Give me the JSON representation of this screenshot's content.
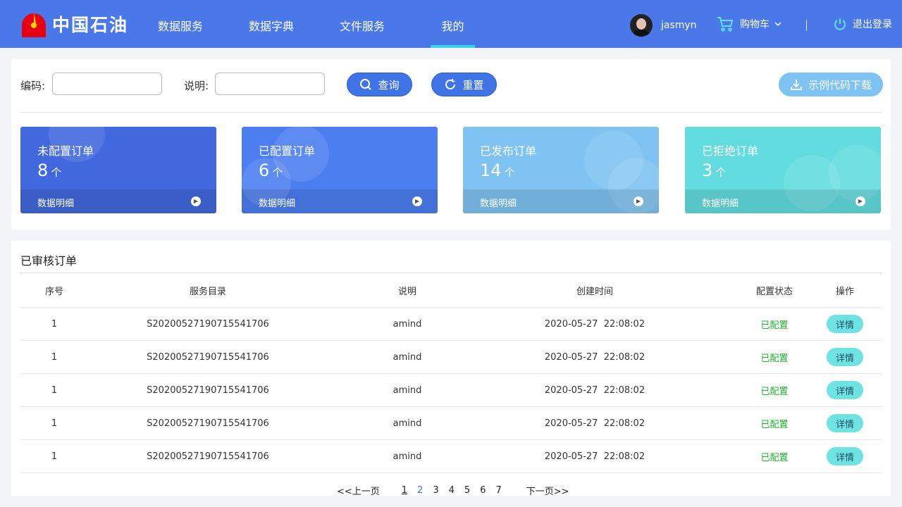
{
  "header": {
    "brand": "中国石油",
    "nav": [
      {
        "label": "数据服务",
        "active": false
      },
      {
        "label": "数据字典",
        "active": false
      },
      {
        "label": "文件服务",
        "active": false
      },
      {
        "label": "我的",
        "active": true
      }
    ],
    "username": "jasmyn",
    "cart_label": "购物车",
    "logout_label": "退出登录"
  },
  "filters": {
    "code_label": "编码:",
    "code_value": "",
    "desc_label": "说明:",
    "desc_value": "",
    "search_label": "查询",
    "reset_label": "重置",
    "download_label": "示例代码下载"
  },
  "cards": [
    {
      "title": "未配置订单",
      "count": "8",
      "unit": "个",
      "footer": "数据明细",
      "color": "#4169dd"
    },
    {
      "title": "已配置订单",
      "count": "6",
      "unit": "个",
      "footer": "数据明细",
      "color": "#4c7ef0"
    },
    {
      "title": "已发布订单",
      "count": "14",
      "unit": "个",
      "footer": "数据明细",
      "color": "#7ec3f2"
    },
    {
      "title": "已拒绝订单",
      "count": "3",
      "unit": "个",
      "footer": "数据明细",
      "color": "#62dcde"
    }
  ],
  "table": {
    "title": "已审核订单",
    "columns": [
      "序号",
      "服务目录",
      "说明",
      "创建时间",
      "配置状态",
      "操作"
    ],
    "rows": [
      {
        "index": "1",
        "catalog": "S20200527190715541706",
        "desc": "amind",
        "created": "2020-05-27  22:08:02",
        "status": "已配置",
        "action": "详情"
      },
      {
        "index": "1",
        "catalog": "S20200527190715541706",
        "desc": "amind",
        "created": "2020-05-27  22:08:02",
        "status": "已配置",
        "action": "详情"
      },
      {
        "index": "1",
        "catalog": "S20200527190715541706",
        "desc": "amind",
        "created": "2020-05-27  22:08:02",
        "status": "已配置",
        "action": "详情"
      },
      {
        "index": "1",
        "catalog": "S20200527190715541706",
        "desc": "amind",
        "created": "2020-05-27  22:08:02",
        "status": "已配置",
        "action": "详情"
      },
      {
        "index": "1",
        "catalog": "S20200527190715541706",
        "desc": "amind",
        "created": "2020-05-27  22:08:02",
        "status": "已配置",
        "action": "详情"
      }
    ]
  },
  "pagination": {
    "prev": "<<上一页",
    "pages": [
      "1",
      "2",
      "3",
      "4",
      "5",
      "6",
      "7"
    ],
    "next": "下一页>>",
    "underlined": "1",
    "highlighted": "2"
  },
  "colors": {
    "header_bg": "#4a78e8",
    "nav_active_indicator": "#35d6ee",
    "primary_button": "#3f73e6",
    "download_button": "#7ec3f2",
    "status_configured": "#21b231",
    "detail_button": "#6fe3e1"
  }
}
